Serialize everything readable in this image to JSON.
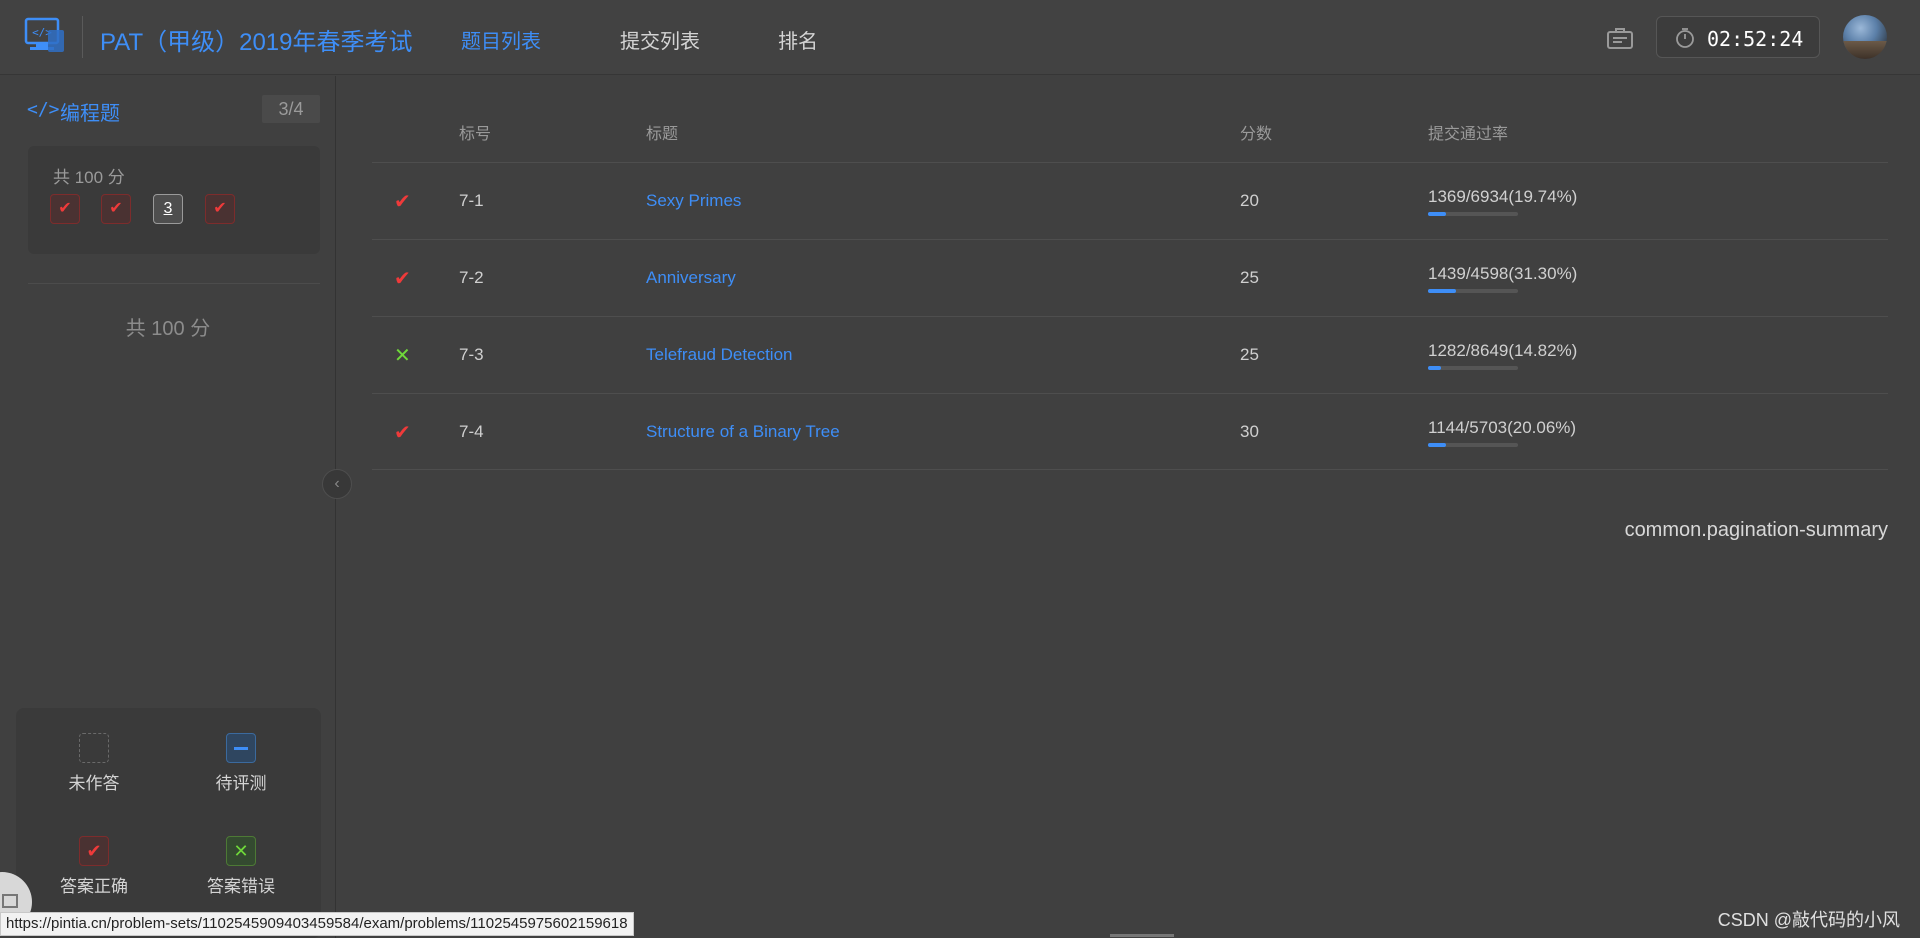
{
  "header": {
    "logo_icon": "code-monitor-icon",
    "app_title": "PAT（甲级）2019年春季考试",
    "nav": [
      {
        "label": "题目列表",
        "active": true
      },
      {
        "label": "提交列表",
        "active": false
      },
      {
        "label": "排名",
        "active": false
      }
    ],
    "briefcase_icon": "briefcase-icon",
    "timer_icon": "stopwatch-icon",
    "timer": "02:52:24",
    "avatar": "avatar"
  },
  "sidebar": {
    "title_icon": "code-icon",
    "title": "编程题",
    "count": "3/4",
    "card_score": "共 100 分",
    "questions": [
      {
        "label": "✔",
        "state": "correct"
      },
      {
        "label": "✔",
        "state": "correct"
      },
      {
        "label": "3",
        "state": "current"
      },
      {
        "label": "✔",
        "state": "correct"
      }
    ],
    "total": "共 100 分",
    "collapse_icon": "chevron-left-icon",
    "legend": [
      {
        "label": "未作答",
        "type": "unanswered"
      },
      {
        "label": "待评测",
        "type": "pending"
      },
      {
        "label": "答案正确",
        "type": "correct",
        "mark": "✔"
      },
      {
        "label": "答案错误",
        "type": "wrong",
        "mark": "✕"
      }
    ]
  },
  "table": {
    "headers": {
      "number": "标号",
      "title": "标题",
      "score": "分数",
      "rate": "提交通过率"
    },
    "rows": [
      {
        "status": "✔",
        "status_type": "correct",
        "number": "7-1",
        "title": "Sexy Primes",
        "score": "20",
        "rate": "1369/6934(19.74%)",
        "rate_fraction": 0.1974
      },
      {
        "status": "✔",
        "status_type": "correct",
        "number": "7-2",
        "title": "Anniversary",
        "score": "25",
        "rate": "1439/4598(31.30%)",
        "rate_fraction": 0.313
      },
      {
        "status": "✕",
        "status_type": "wrong",
        "number": "7-3",
        "title": "Telefraud Detection",
        "score": "25",
        "rate": "1282/8649(14.82%)",
        "rate_fraction": 0.1482
      },
      {
        "status": "✔",
        "status_type": "correct",
        "number": "7-4",
        "title": "Structure of a Binary Tree",
        "score": "30",
        "rate": "1144/5703(20.06%)",
        "rate_fraction": 0.2006
      }
    ],
    "pagination_summary": "common.pagination-summary"
  },
  "status_url": "https://pintia.cn/problem-sets/1102545909403459584/exam/problems/1102545975602159618",
  "watermark": "CSDN @敲代码的小风",
  "colors": {
    "accent": "#3e8ef7",
    "correct": "#ef3a3a",
    "wrong": "#6fd93a",
    "background": "#404040"
  }
}
